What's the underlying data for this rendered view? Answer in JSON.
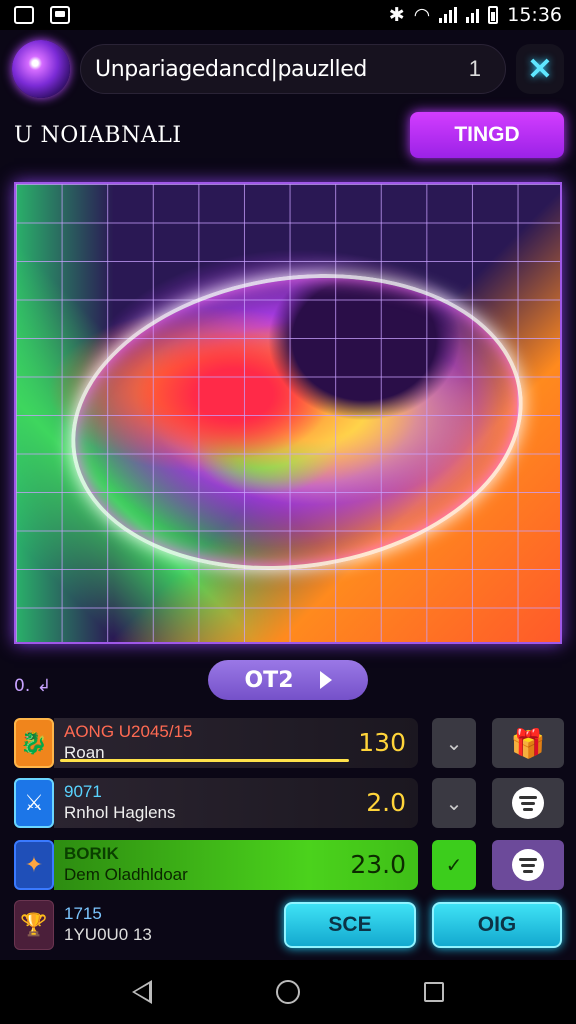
{
  "status_bar": {
    "time": "15:36"
  },
  "header": {
    "title": "Unpariagedancd|pauzlled",
    "count": "1",
    "close_glyph": "✕"
  },
  "subheader": {
    "level_label": "U NOIABNALI",
    "action_button": "TINGD"
  },
  "pager": {
    "label": "0.  ↲",
    "button_label": "OT2"
  },
  "rows": [
    {
      "title": "AONG U2045/15",
      "subtitle": "Roan",
      "value": "130",
      "progress": 0.85,
      "icon": "dragon-icon",
      "action_icon": "gift-icon"
    },
    {
      "title": "9071",
      "subtitle": "Rnhol Haglens",
      "value": "2.0",
      "icon": "warrior-icon",
      "action_icon": "menu-icon"
    },
    {
      "title": "BORIK",
      "subtitle": "Dem Oladhldoar",
      "value": "23.0",
      "icon": "star-icon",
      "action_icon": "menu-icon",
      "selected": true
    },
    {
      "title": "1715",
      "subtitle": "1YU0U0 13",
      "icon": "trophy-icon"
    }
  ],
  "bottom_buttons": {
    "left": "SCE",
    "right": "OIG"
  },
  "colors": {
    "accent_purple": "#b63bff",
    "accent_cyan": "#31d3ff",
    "accent_green": "#4bd21c",
    "value_yellow": "#ffd43a"
  }
}
